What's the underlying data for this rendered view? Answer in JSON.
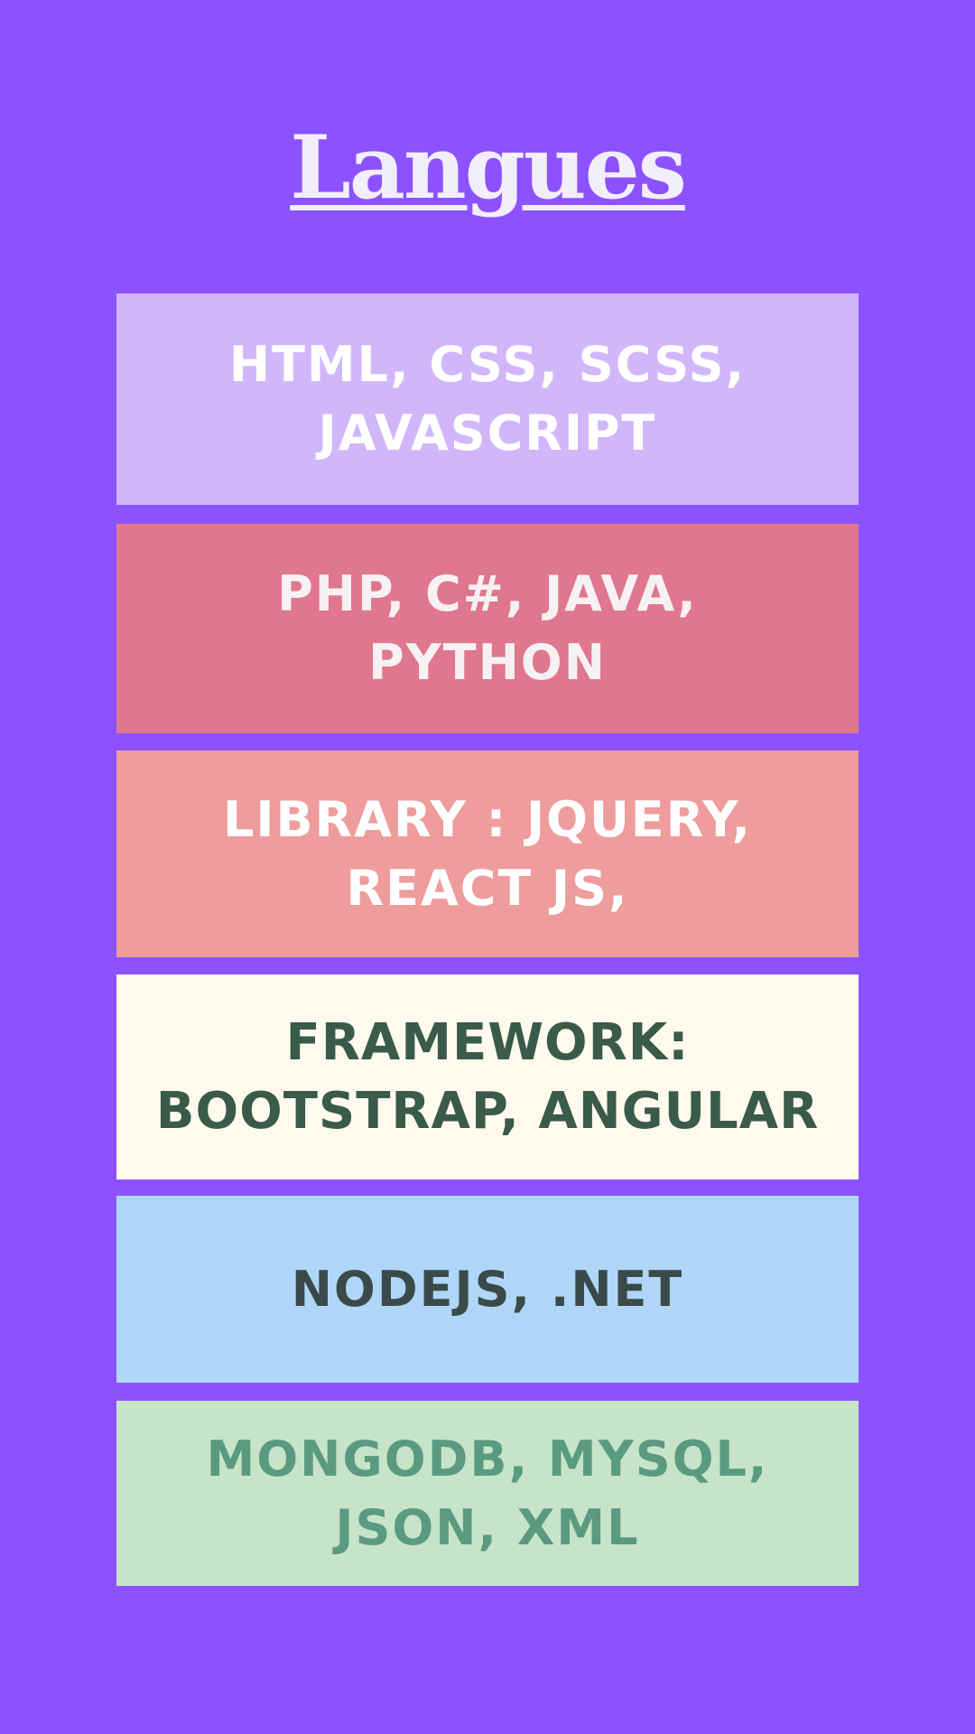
{
  "title": "Langues",
  "items": [
    {
      "text": "HTML, CSS, SCSS,\nJAVASCRIPT",
      "bg": "#d1b7fa",
      "color": "#ffffff"
    },
    {
      "text": "PHP, C#, JAVA,\nPYTHON",
      "bg": "#df778f",
      "color": "#f7f1f3"
    },
    {
      "text": "LIBRARY : JQUERY,\nREACT JS,",
      "bg": "#ef9c9c",
      "color": "#ffffff"
    },
    {
      "text": "FRAMEWORK:\nBOOTSTRAP, ANGULAR",
      "bg": "#fffaee",
      "color": "#3a5a4a"
    },
    {
      "text": "NODEJS, .NET",
      "bg": "#b0d6f7",
      "color": "#3a4a4a"
    },
    {
      "text": "MONGODB, MYSQL,\nJSON, XML",
      "bg": "#c7e4c9",
      "color": "#5a9a80"
    }
  ]
}
